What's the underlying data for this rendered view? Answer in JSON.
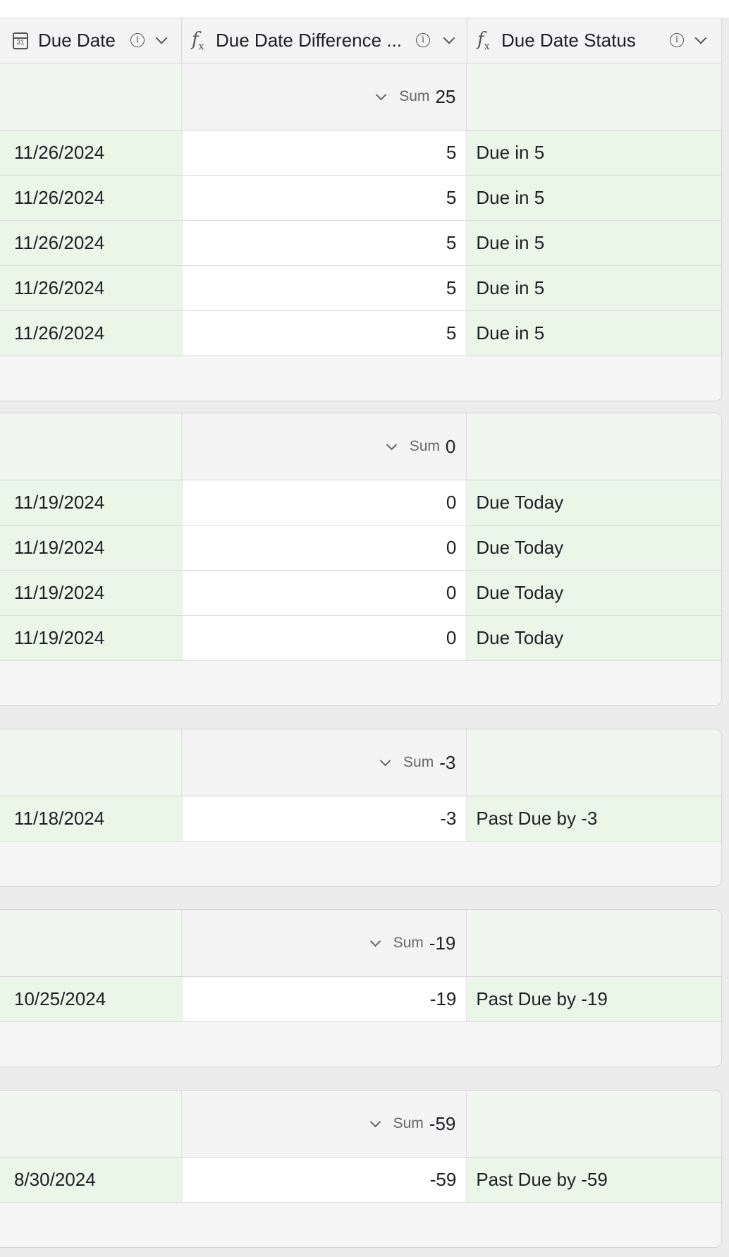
{
  "columns": {
    "due_date": {
      "label": "Due Date",
      "icon": "calendar-icon",
      "icon_text": "31"
    },
    "difference": {
      "label": "Due Date Difference ...",
      "icon": "formula-icon"
    },
    "status": {
      "label": "Due Date Status",
      "icon": "formula-icon"
    },
    "info_glyph": "i"
  },
  "sum_label": "Sum",
  "groups": [
    {
      "sum": "25",
      "rows": [
        {
          "date": "11/26/2024",
          "diff": "5",
          "status": "Due in 5"
        },
        {
          "date": "11/26/2024",
          "diff": "5",
          "status": "Due in 5"
        },
        {
          "date": "11/26/2024",
          "diff": "5",
          "status": "Due in 5"
        },
        {
          "date": "11/26/2024",
          "diff": "5",
          "status": "Due in 5"
        },
        {
          "date": "11/26/2024",
          "diff": "5",
          "status": "Due in 5"
        }
      ]
    },
    {
      "sum": "0",
      "rows": [
        {
          "date": "11/19/2024",
          "diff": "0",
          "status": "Due Today"
        },
        {
          "date": "11/19/2024",
          "diff": "0",
          "status": "Due Today"
        },
        {
          "date": "11/19/2024",
          "diff": "0",
          "status": "Due Today"
        },
        {
          "date": "11/19/2024",
          "diff": "0",
          "status": "Due Today"
        }
      ]
    },
    {
      "sum": "-3",
      "rows": [
        {
          "date": "11/18/2024",
          "diff": "-3",
          "status": "Past Due by -3"
        }
      ]
    },
    {
      "sum": "-19",
      "rows": [
        {
          "date": "10/25/2024",
          "diff": "-19",
          "status": "Past Due by -19"
        }
      ]
    },
    {
      "sum": "-59",
      "rows": [
        {
          "date": "8/30/2024",
          "diff": "-59",
          "status": "Past Due by -59"
        }
      ]
    }
  ],
  "colors": {
    "date_cell_bg": "#eaf7e8",
    "status_cell_bg": "#eaf7e8",
    "group_bg": "#f5f5f5"
  }
}
